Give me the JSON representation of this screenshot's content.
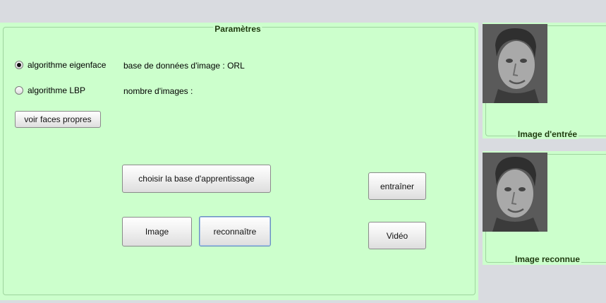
{
  "params": {
    "title": "Paramètres",
    "radio_eigenface": "algorithme eigenface",
    "radio_lbp": "algorithme LBP",
    "selected_algorithm": "eigenface",
    "db_label": "base de données  d'image : ORL",
    "count_label": "nombre d'images :",
    "btn_voir": "voir faces propres",
    "btn_choisir": "choisir la base d'apprentissage",
    "btn_image": "Image",
    "btn_reconnaitre": "reconnaître",
    "btn_entrainer": "entraîner",
    "btn_video": "Vidéo"
  },
  "images": {
    "input_caption": "Image d'entrée",
    "recognized_caption": "Image reconnue"
  },
  "colors": {
    "panel": "#ccffcc",
    "border": "#9ed49e",
    "background": "#d9dbe0"
  }
}
